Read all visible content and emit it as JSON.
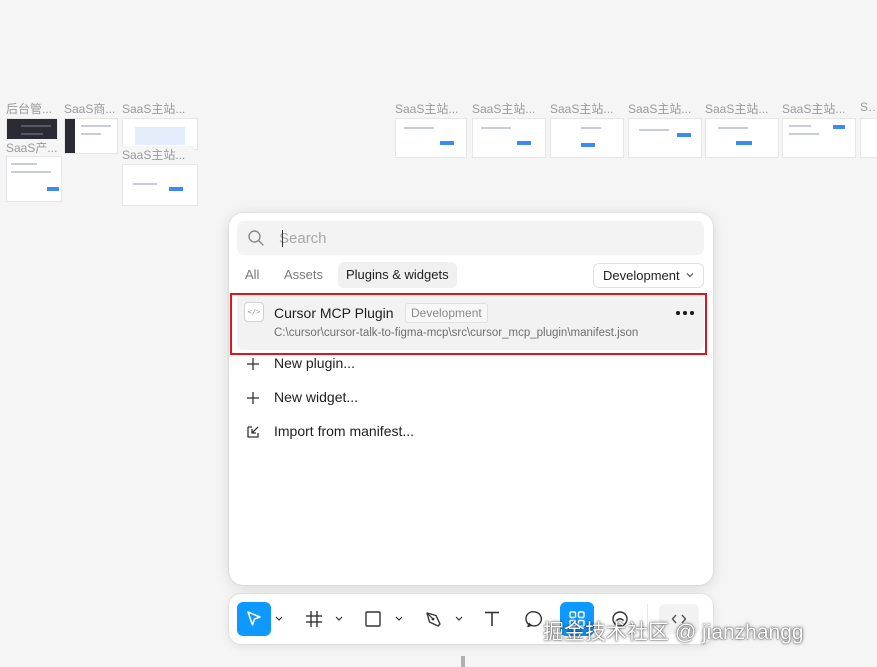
{
  "canvas": {
    "frames": [
      {
        "label": "后台管..."
      },
      {
        "label": "SaaS商..."
      },
      {
        "label": "SaaS主站..."
      },
      {
        "label": "SaaS产..."
      },
      {
        "label": "SaaS主站..."
      },
      {
        "label": "SaaS主站..."
      },
      {
        "label": "SaaS主站..."
      },
      {
        "label": "SaaS主站..."
      },
      {
        "label": "SaaS主站..."
      },
      {
        "label": "SaaS主站..."
      },
      {
        "label": "SaaS主站..."
      },
      {
        "label": "Saa"
      }
    ]
  },
  "dialog": {
    "search": {
      "placeholder": "Search",
      "value": ""
    },
    "tabs": [
      {
        "label": "All",
        "active": false
      },
      {
        "label": "Assets",
        "active": false
      },
      {
        "label": "Plugins & widgets",
        "active": true
      }
    ],
    "filter": {
      "selected": "Development"
    },
    "plugin": {
      "name": "Cursor MCP Plugin",
      "badge": "Development",
      "path": "C:\\cursor\\cursor-talk-to-figma-mcp\\src\\cursor_mcp_plugin\\manifest.json",
      "icon": "code-icon"
    },
    "actions": [
      {
        "label": "New plugin...",
        "icon": "plus-icon"
      },
      {
        "label": "New widget...",
        "icon": "plus-icon"
      },
      {
        "label": "Import from manifest...",
        "icon": "import-icon"
      }
    ]
  },
  "toolbar": {
    "tools": [
      {
        "name": "move-tool",
        "icon": "cursor-arrow-icon",
        "active": true
      },
      {
        "name": "frame-tool",
        "icon": "hash-frame-icon",
        "active": false
      },
      {
        "name": "shape-tool",
        "icon": "rectangle-icon",
        "active": false
      },
      {
        "name": "pen-tool",
        "icon": "pen-icon",
        "active": false
      },
      {
        "name": "text-tool",
        "icon": "text-icon",
        "active": false
      },
      {
        "name": "comment-tool",
        "icon": "comment-icon",
        "active": false
      },
      {
        "name": "actions-tool",
        "icon": "resources-icon",
        "active": true
      },
      {
        "name": "audio-tool",
        "icon": "audio-icon",
        "active": false
      },
      {
        "name": "dev-mode-toggle",
        "icon": "code-icon",
        "active": false
      }
    ]
  },
  "watermark": "掘金技术社区 @ jianzhangg",
  "colors": {
    "accent": "#0d99ff",
    "highlight_border": "#e3131a",
    "canvas_bg": "#f5f5f5"
  }
}
